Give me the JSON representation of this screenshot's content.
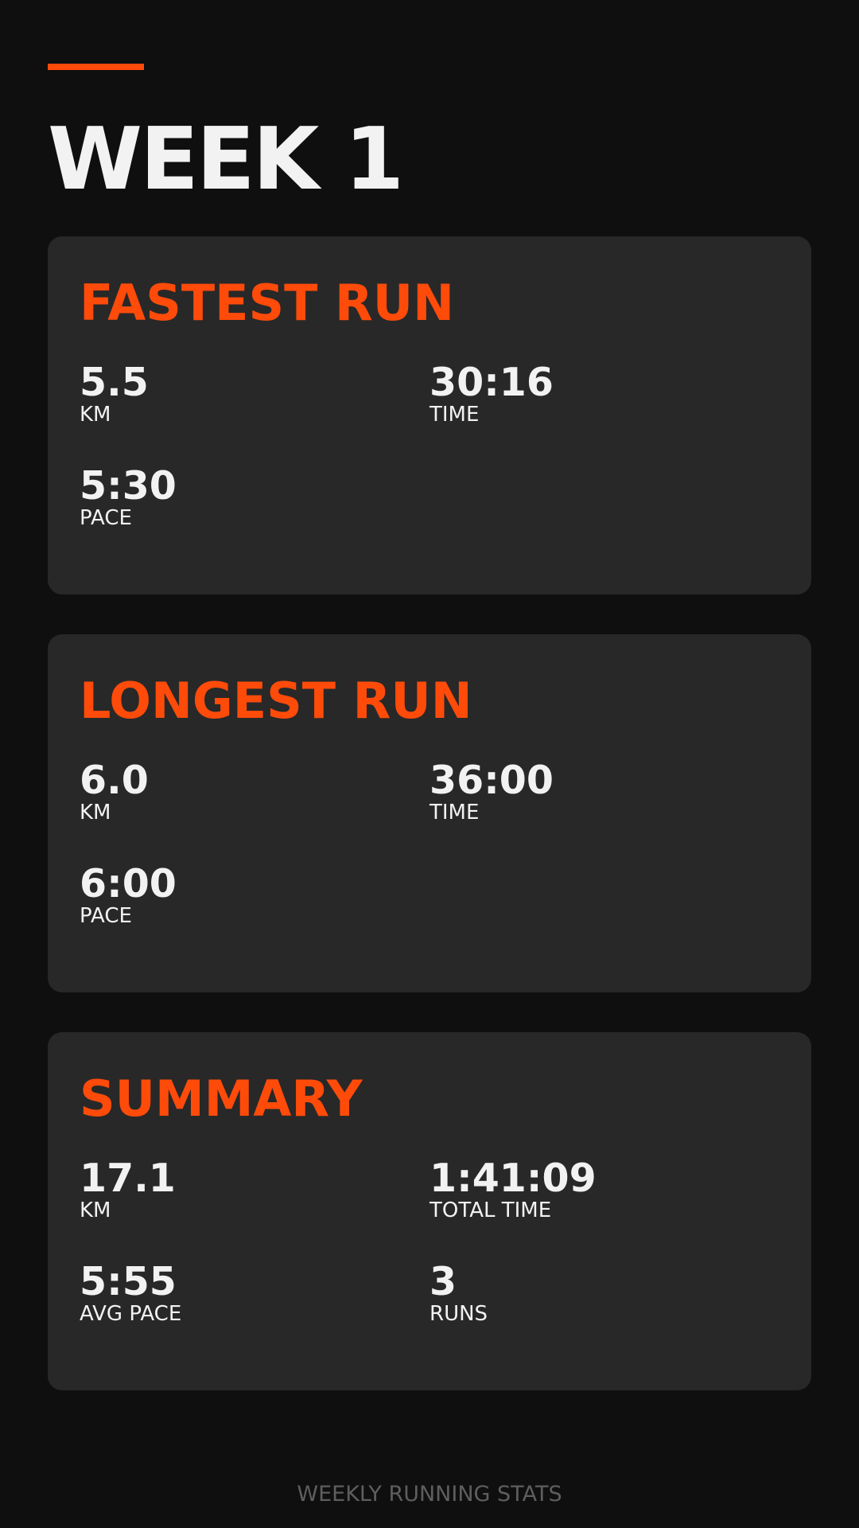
{
  "header": {
    "title": "WEEK 1"
  },
  "fastest_run": {
    "title": "FASTEST RUN",
    "km_value": "5.5",
    "km_label": "KM",
    "time_value": "30:16",
    "time_label": "TIME",
    "pace_value": "5:30",
    "pace_label": "PACE"
  },
  "longest_run": {
    "title": "LONGEST RUN",
    "km_value": "6.0",
    "km_label": "KM",
    "time_value": "36:00",
    "time_label": "TIME",
    "pace_value": "6:00",
    "pace_label": "PACE"
  },
  "summary": {
    "title": "SUMMARY",
    "km_value": "17.1",
    "km_label": "KM",
    "total_time_value": "1:41:09",
    "total_time_label": "TOTAL TIME",
    "avg_pace_value": "5:55",
    "avg_pace_label": "AVG PACE",
    "runs_value": "3",
    "runs_label": "RUNS"
  },
  "footer": {
    "text": "WEEKLY RUNNING STATS"
  },
  "colors": {
    "background": "#0f0f0f",
    "card": "#282828",
    "accent": "#ff4b0a",
    "text": "#f2f2f2",
    "muted": "#5e5e5e"
  }
}
